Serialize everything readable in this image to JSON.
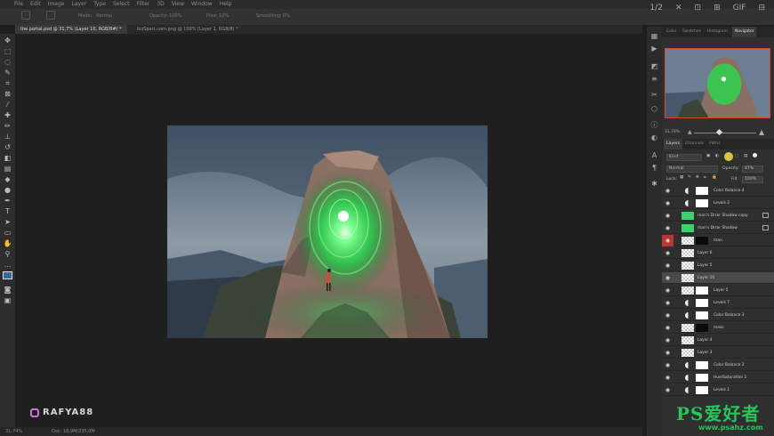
{
  "menubar": {
    "items": [
      "File",
      "Edit",
      "Image",
      "Layer",
      "Type",
      "Select",
      "Filter",
      "3D",
      "View",
      "Window",
      "Help"
    ],
    "right_controls": [
      "1/2",
      "✕",
      "⊡",
      "⊞",
      "GIF",
      "⊟"
    ]
  },
  "options": {
    "mode_label": "Mode:",
    "mode_value": "Normal",
    "opacity_label": "Opacity:",
    "opacity_value": "100%",
    "flow_label": "Flow:",
    "flow_value": "10%",
    "smoothing_label": "Smoothing:",
    "smoothing_value": "0%"
  },
  "document_tabs": [
    {
      "label": "the portal.psd @ 31,7% (Layer 10, RGB/8#) *",
      "active": true
    },
    {
      "label": "bizSpart.com.png @ 100% (Layer 1, RGB/8) *",
      "active": false
    }
  ],
  "status": {
    "zoom": "31,74%",
    "doc_info": "Doc: 18,9M/235,0M"
  },
  "watermark": {
    "text": "RAFYA88"
  },
  "panel_tabs": [
    "Color",
    "Swatches",
    "Histogram",
    "Navigator"
  ],
  "active_panel_tab": "Navigator",
  "navigator": {
    "zoom": "31,74%"
  },
  "layers_tabs": [
    "Layers",
    "Channels",
    "Paths"
  ],
  "layers_controls": {
    "filter": "Kind",
    "blend_mode": "Normal",
    "opacity_label": "Opacity:",
    "opacity_value": "87%",
    "lock_label": "Lock:",
    "fill_label": "Fill:",
    "fill_value": "100%"
  },
  "layers": [
    {
      "name": "Color Balance 4",
      "type": "adjustment"
    },
    {
      "name": "Levels 2",
      "type": "adjustment"
    },
    {
      "name": "man's Drrar Shadow copy",
      "type": "green"
    },
    {
      "name": "man's Drrar Shadow",
      "type": "green"
    },
    {
      "name": "man",
      "type": "masked",
      "red": true
    },
    {
      "name": "Layer 6",
      "type": "pixel"
    },
    {
      "name": "Layer 5",
      "type": "pixel"
    },
    {
      "name": "Layer 10",
      "type": "pixel",
      "selected": true
    },
    {
      "name": "Layer 5",
      "type": "pixelmask"
    },
    {
      "name": "Levels 7",
      "type": "adjustment"
    },
    {
      "name": "Color Balance 3",
      "type": "adjustment"
    },
    {
      "name": "mass",
      "type": "masked"
    },
    {
      "name": "Layer 4",
      "type": "pixel"
    },
    {
      "name": "Layer 3",
      "type": "pixel"
    },
    {
      "name": "Color Balance 2",
      "type": "adjustment"
    },
    {
      "name": "Hue/Saturation 1",
      "type": "adjustment"
    },
    {
      "name": "Levels 1",
      "type": "adjustment"
    }
  ],
  "site_watermark": {
    "brand": "PS爱好者",
    "url": "www.psahz.com"
  },
  "colors": {
    "accent_red": "#d34836",
    "portal_green": "#3fd06b"
  }
}
